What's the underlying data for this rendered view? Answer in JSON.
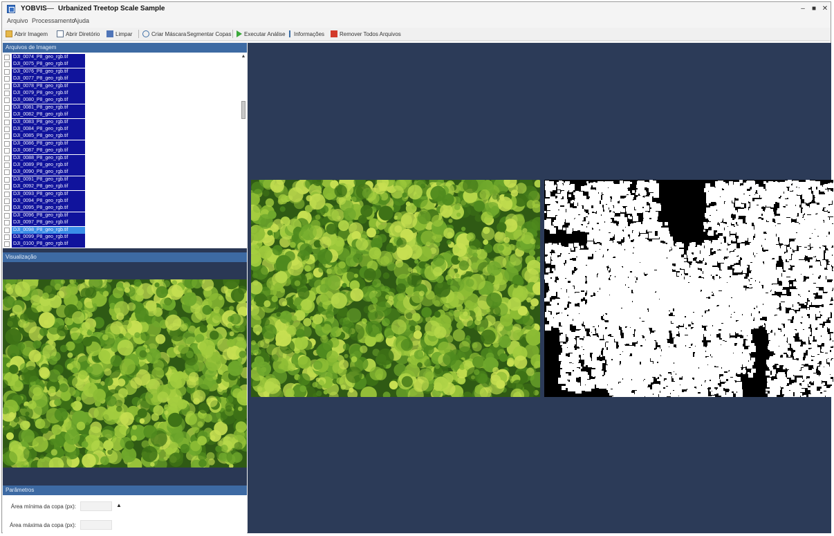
{
  "window": {
    "app_name": "YOBVIS",
    "title_separator": "—",
    "document_title": "Urbanized Treetop Scale Sample",
    "minimize_glyph": "–",
    "maximize_glyph": "■",
    "close_glyph": "✕"
  },
  "menu": [
    "Arquivo",
    "Processamento",
    "Ajuda"
  ],
  "toolbar": [
    {
      "label": "Abrir Imagem",
      "icon": "folder-icon",
      "color": "#e6b84a"
    },
    {
      "label": "Abrir Diretório",
      "icon": "open-dir-icon",
      "color": "#5a6f8a"
    },
    {
      "label": "Limpar",
      "icon": "clear-icon",
      "color": "#4f75b8"
    },
    {
      "label": "Criar Máscara",
      "icon": "mask-icon",
      "color": "#3c6ea6"
    },
    {
      "label": "Segmentar Copas",
      "icon": "segment-icon",
      "color": "#3c6ea6"
    },
    {
      "label": "Executar Análise",
      "icon": "play-icon",
      "color": "#3aa83a"
    },
    {
      "label": "Informações",
      "icon": "info-icon",
      "color": "#3c6ea6"
    },
    {
      "label": "Remover Todos Arquivos",
      "icon": "remove-icon",
      "color": "#d23a2a"
    }
  ],
  "file_panel": {
    "header": "Arquivos de Imagem",
    "files": [
      "DJI_0074_P8_geo_rgb.tif",
      "DJI_0075_P8_geo_rgb.tif",
      "DJI_0076_P8_geo_rgb.tif",
      "DJI_0077_P8_geo_rgb.tif",
      "DJI_0078_P8_geo_rgb.tif",
      "DJI_0079_P8_geo_rgb.tif",
      "DJI_0080_P8_geo_rgb.tif",
      "DJI_0081_P8_geo_rgb.tif",
      "DJI_0082_P8_geo_rgb.tif",
      "DJI_0083_P8_geo_rgb.tif",
      "DJI_0084_P8_geo_rgb.tif",
      "DJI_0085_P8_geo_rgb.tif",
      "DJI_0086_P8_geo_rgb.tif",
      "DJI_0087_P8_geo_rgb.tif",
      "DJI_0088_P8_geo_rgb.tif",
      "DJI_0089_P8_geo_rgb.tif",
      "DJI_0090_P8_geo_rgb.tif",
      "DJI_0091_P8_geo_rgb.tif",
      "DJI_0092_P8_geo_rgb.tif",
      "DJI_0093_P8_geo_rgb.tif",
      "DJI_0094_P8_geo_rgb.tif",
      "DJI_0095_P8_geo_rgb.tif",
      "DJI_0096_P8_geo_rgb.tif",
      "DJI_0097_P8_geo_rgb.tif",
      "DJI_0098_P8_geo_rgb.tif",
      "DJI_0099_P8_geo_rgb.tif",
      "DJI_0100_P8_geo_rgb.tif"
    ],
    "selected_index": 24
  },
  "preview_panel": {
    "header": "Visualização"
  },
  "params_panel": {
    "header": "Parâmetros",
    "fields": [
      {
        "label": "Área mínima da copa (px):",
        "value": ""
      },
      {
        "label": "Área máxima da copa (px):",
        "value": ""
      }
    ]
  },
  "colors": {
    "panel_bg": "#2c3b58",
    "header_blue": "#3d6aa3",
    "list_selection": "#10139c",
    "list_focus": "#3a8ee8",
    "canopy_dark": "#2f5a14",
    "canopy_mid": "#6fa82c",
    "canopy_light": "#b6d84a"
  }
}
